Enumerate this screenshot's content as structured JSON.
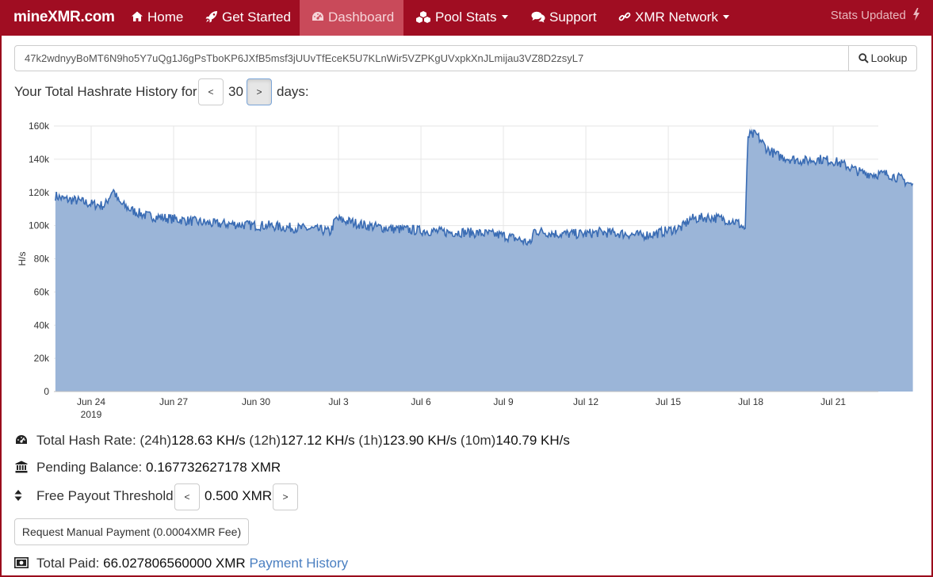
{
  "nav": {
    "brand": "mineXMR.com",
    "items": [
      {
        "label": "Home",
        "icon": "home-icon"
      },
      {
        "label": "Get Started",
        "icon": "rocket-icon"
      },
      {
        "label": "Dashboard",
        "icon": "dashboard-icon",
        "active": true
      },
      {
        "label": "Pool Stats",
        "icon": "cubes-icon",
        "dropdown": true
      },
      {
        "label": "Support",
        "icon": "comments-icon"
      },
      {
        "label": "XMR Network",
        "icon": "link-icon",
        "dropdown": true
      }
    ],
    "stats_updated": "Stats Updated",
    "accent": "#a00d22"
  },
  "lookup": {
    "address": "47k2wdnyyBoMT6N9ho5Y7uQg1J6gPsTboKP6JXfB5msf3jUUvTfEceK5U7KLnWir5VZPKgUVxpkXnJLmijau3VZ8D2zsyL7",
    "button_label": "Lookup"
  },
  "history": {
    "prefix": "Your Total Hashrate History for",
    "days": "30",
    "suffix": "days:",
    "prev_label": "<",
    "next_label": ">"
  },
  "chart_data": {
    "type": "area",
    "ylabel": "H/s",
    "ylim": [
      0,
      160000
    ],
    "yticks": [
      "0",
      "20k",
      "40k",
      "60k",
      "80k",
      "100k",
      "120k",
      "140k",
      "160k"
    ],
    "xticks": [
      {
        "label": "Jun 24",
        "sub": "2019",
        "day": 0
      },
      {
        "label": "Jun 27",
        "day": 3
      },
      {
        "label": "Jun 30",
        "day": 6
      },
      {
        "label": "Jul 3",
        "day": 9
      },
      {
        "label": "Jul 6",
        "day": 12
      },
      {
        "label": "Jul 9",
        "day": 15
      },
      {
        "label": "Jul 12",
        "day": 18
      },
      {
        "label": "Jul 15",
        "day": 21
      },
      {
        "label": "Jul 18",
        "day": 24
      },
      {
        "label": "Jul 21",
        "day": 27
      }
    ],
    "grid": true,
    "series": [
      {
        "color": "#3a6cb4",
        "fill": "#9bb5d8",
        "points": [
          [
            -1.3,
            118000
          ],
          [
            -1.0,
            116000
          ],
          [
            -0.5,
            115000
          ],
          [
            0.0,
            113000
          ],
          [
            0.5,
            112000
          ],
          [
            0.8,
            122000
          ],
          [
            1.0,
            114000
          ],
          [
            1.5,
            109000
          ],
          [
            2.0,
            106000
          ],
          [
            2.5,
            105000
          ],
          [
            3.0,
            104000
          ],
          [
            3.5,
            103000
          ],
          [
            4.0,
            102000
          ],
          [
            4.5,
            101000
          ],
          [
            5.0,
            101000
          ],
          [
            5.5,
            100500
          ],
          [
            6.0,
            100000
          ],
          [
            6.5,
            100000
          ],
          [
            7.0,
            99000
          ],
          [
            7.5,
            98500
          ],
          [
            8.0,
            98000
          ],
          [
            8.5,
            97000
          ],
          [
            8.7,
            96000
          ],
          [
            8.9,
            104000
          ],
          [
            9.5,
            102000
          ],
          [
            10.0,
            100000
          ],
          [
            10.5,
            99000
          ],
          [
            11.0,
            98000
          ],
          [
            11.5,
            97500
          ],
          [
            12.0,
            97000
          ],
          [
            12.5,
            96500
          ],
          [
            13.0,
            96000
          ],
          [
            13.5,
            96000
          ],
          [
            14.0,
            95500
          ],
          [
            14.5,
            95000
          ],
          [
            15.0,
            94000
          ],
          [
            15.5,
            92000
          ],
          [
            16.0,
            89000
          ],
          [
            16.1,
            97000
          ],
          [
            16.5,
            96000
          ],
          [
            17.0,
            95000
          ],
          [
            17.5,
            95000
          ],
          [
            18.0,
            95000
          ],
          [
            18.5,
            96000
          ],
          [
            19.0,
            95500
          ],
          [
            19.5,
            95000
          ],
          [
            20.0,
            94000
          ],
          [
            20.5,
            95000
          ],
          [
            21.0,
            97000
          ],
          [
            21.5,
            99000
          ],
          [
            21.8,
            104000
          ],
          [
            22.5,
            105000
          ],
          [
            23.0,
            104000
          ],
          [
            23.5,
            102000
          ],
          [
            23.8,
            98000
          ],
          [
            23.9,
            154000
          ],
          [
            24.2,
            155000
          ],
          [
            24.6,
            146000
          ],
          [
            25.0,
            142000
          ],
          [
            25.5,
            140000
          ],
          [
            26.0,
            139000
          ],
          [
            26.5,
            140000
          ],
          [
            27.0,
            139000
          ],
          [
            27.5,
            136000
          ],
          [
            28.0,
            132000
          ],
          [
            28.5,
            131000
          ],
          [
            29.0,
            131000
          ],
          [
            29.5,
            128000
          ],
          [
            29.9,
            124000
          ]
        ]
      }
    ]
  },
  "stats": {
    "hash_rate_label": "Total Hash Rate:",
    "r24_label": "(24h)",
    "r24": "128.63 KH/s",
    "r12_label": "(12h)",
    "r12": "127.12 KH/s",
    "r1_label": "(1h)",
    "r1": "123.90 KH/s",
    "r10m_label": "(10m)",
    "r10m": "140.79 KH/s",
    "pending_label": "Pending Balance:",
    "pending_value": "0.167732627178 XMR",
    "threshold_label": "Free Payout Threshold:",
    "threshold_value": "0.500 XMR",
    "threshold_prev": "<",
    "threshold_next": ">",
    "request_button": "Request Manual Payment (0.0004XMR Fee)",
    "paid_label": "Total Paid:",
    "paid_value": "66.027806560000 XMR",
    "payment_history": "Payment History"
  }
}
